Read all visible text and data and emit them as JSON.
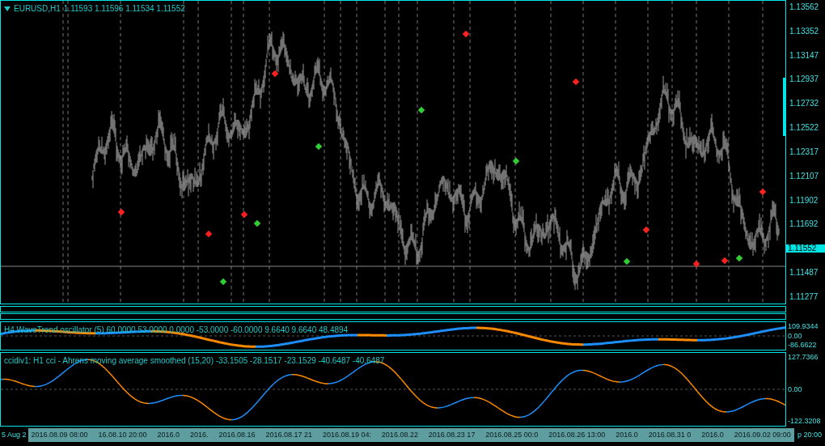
{
  "chart": {
    "symbol": "EURUSD,H1",
    "ohlc": "1.11593 1.11596 1.11534 1.11552"
  },
  "price_axis": [
    {
      "label": "1.13562",
      "kind": "tick"
    },
    {
      "label": "1.13352",
      "kind": "tick"
    },
    {
      "label": "1.13147",
      "kind": "tick"
    },
    {
      "label": "1.12937",
      "kind": "tick"
    },
    {
      "label": "1.12732",
      "kind": "tick"
    },
    {
      "label": "1.12522",
      "kind": "tick"
    },
    {
      "label": "1.12317",
      "kind": "tick"
    },
    {
      "label": "1.12107",
      "kind": "tick"
    },
    {
      "label": "1.11902",
      "kind": "tick"
    },
    {
      "label": "1.11692",
      "kind": "tick"
    },
    {
      "label": "1.11552",
      "kind": "current"
    },
    {
      "label": "1.11487",
      "kind": "tick"
    },
    {
      "label": "1.11277",
      "kind": "tick"
    }
  ],
  "indicators": [
    {
      "title": "H4 WaveTrend oscillator (5) 60.0000 53.0000 0.0000 -53.0000 -60.0000 9.6640 9.6640 48.4894",
      "axis": [
        "109.9344",
        "0.00",
        "-86.6622"
      ],
      "kind": "wave"
    },
    {
      "title": "ccidiv1: H1 cci  - Ahrens moving average smoothed (15,20) -33.1505 -28.1517 -23.1529 -40.6487 -40.6487",
      "axis": [
        "127.7366",
        "0.00",
        "-122.3208"
      ],
      "kind": "cci"
    }
  ],
  "time_axis": {
    "start": "5 Aug 2",
    "end": "p 20:00",
    "labels": [
      "2016.08.09 08:00",
      "16.08.10 20:00",
      "2016.0",
      "2016.",
      "2016.08.16",
      "2016.08.17 21",
      "2016.08.19 04:",
      "2016.08.22",
      "2016.08.23 17",
      "2016.08.25 00:0",
      "2016.08.26 13:00",
      "2016.0",
      "2016.08.31 0",
      "2016.0",
      "2016.09.02 09:00"
    ]
  }
}
